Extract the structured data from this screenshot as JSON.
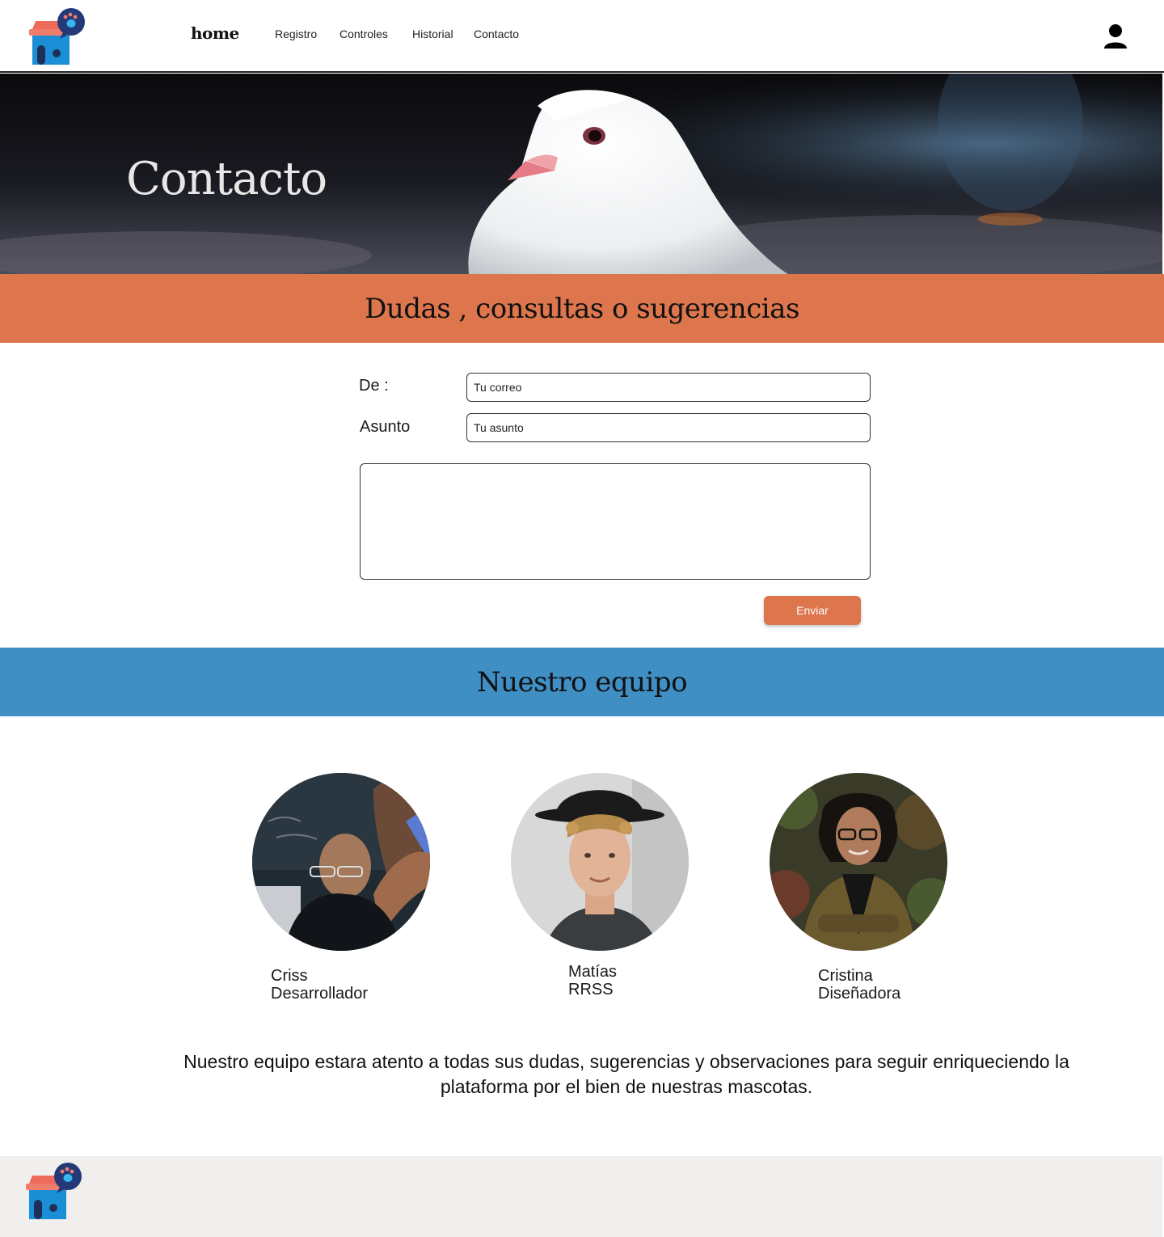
{
  "header": {
    "home_label": "home",
    "nav": [
      "Registro",
      "Controles",
      "Historial",
      "Contacto"
    ],
    "logo_icon": "pet-house-logo-icon",
    "user_icon": "user-icon"
  },
  "hero": {
    "title": "Contacto"
  },
  "contact_form": {
    "section_title": "Dudas , consultas o sugerencias",
    "from_label": "De :",
    "from_placeholder": "Tu correo",
    "subject_label": "Asunto",
    "subject_placeholder": "Tu asunto",
    "message_value": "",
    "submit_label": "Enviar"
  },
  "team": {
    "section_title": "Nuestro equipo",
    "members": [
      {
        "name": "Criss",
        "role": "Desarrollador"
      },
      {
        "name": "Matías",
        "role": "RRSS"
      },
      {
        "name": "Cristina",
        "role": "Diseñadora"
      }
    ],
    "note": "Nuestro equipo estara atento a todas sus dudas, sugerencias y observaciones para seguir enriqueciendo la plataforma por el bien de nuestras mascotas."
  },
  "colors": {
    "accent_orange": "#dd754d",
    "accent_blue": "#3f8fc4",
    "footer_bg": "#f0efee"
  }
}
